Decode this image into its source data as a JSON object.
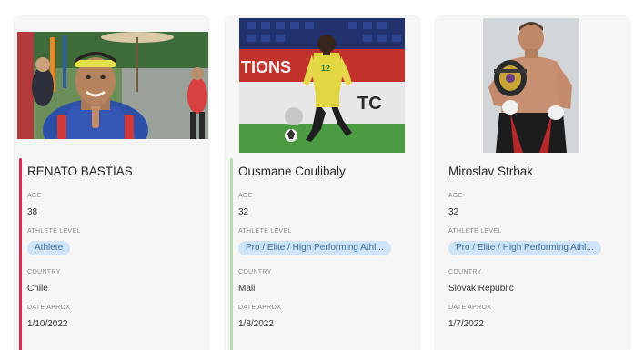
{
  "labels": {
    "age": "AGE",
    "athlete_level": "ATHLETE LEVEL",
    "country": "COUNTRY",
    "date": "DATE APROX"
  },
  "colors": {
    "card_background": "#f6f6f6",
    "accent_red": "#d6294b",
    "accent_green": "#b6dfb0",
    "pill_background": "#cfe4f6",
    "pill_text": "#3b6e9b"
  },
  "athletes": [
    {
      "name": "RENATO BASTÍAS",
      "age": "38",
      "level": "Athlete",
      "country": "Chile",
      "date": "1/10/2022"
    },
    {
      "name": "Ousmane Coulibaly",
      "age": "32",
      "level": "Pro / Elite / High Performing Athl...",
      "country": "Mali",
      "date": "1/8/2022"
    },
    {
      "name": "Miroslav Strbak",
      "age": "32",
      "level": "Pro / Elite / High Performing Athl...",
      "country": "Slovak Republic",
      "date": "1/7/2022"
    }
  ]
}
